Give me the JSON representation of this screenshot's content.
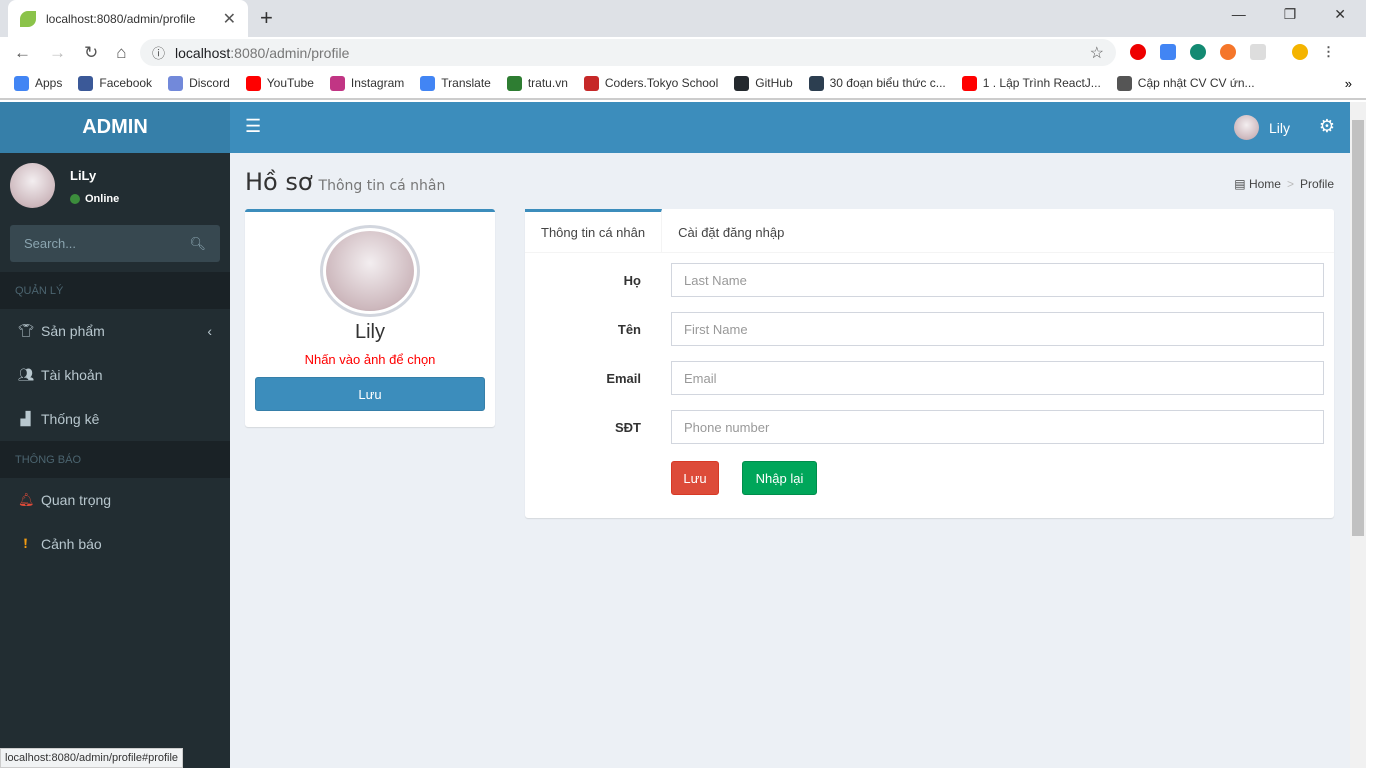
{
  "browser": {
    "tab_title": "localhost:8080/admin/profile",
    "url_host": "localhost",
    "url_rest": ":8080/admin/profile",
    "bookmarks": [
      {
        "label": "Apps",
        "color": "#4285f4"
      },
      {
        "label": "Facebook",
        "color": "#3b5998"
      },
      {
        "label": "Discord",
        "color": "#7289da"
      },
      {
        "label": "YouTube",
        "color": "#ff0000"
      },
      {
        "label": "Instagram",
        "color": "#c13584"
      },
      {
        "label": "Translate",
        "color": "#4285f4"
      },
      {
        "label": "tratu.vn",
        "color": "#2e7d32"
      },
      {
        "label": "Coders.Tokyo School",
        "color": "#c62828"
      },
      {
        "label": "GitHub",
        "color": "#24292e"
      },
      {
        "label": "30 đoạn biểu thức c...",
        "color": "#2c3e50"
      },
      {
        "label": "1 . Lập Trình ReactJ...",
        "color": "#ff0000"
      },
      {
        "label": "Cập nhật CV CV ứn...",
        "color": "#555555"
      }
    ],
    "status_url": "localhost:8080/admin/profile#profile"
  },
  "sidebar": {
    "logo": "ADMIN",
    "user_name": "LiLy",
    "status": "Online",
    "search_placeholder": "Search...",
    "section1": "QUẢN LÝ",
    "items1": [
      {
        "label": "Sản phẩm",
        "icon": "shirt-icon"
      },
      {
        "label": "Tài khoản",
        "icon": "users-icon"
      },
      {
        "label": "Thống kê",
        "icon": "bar-chart-icon"
      }
    ],
    "section2": "THÔNG BÁO",
    "items2": [
      {
        "label": "Quan trọng",
        "icon": "bell-icon"
      },
      {
        "label": "Cảnh báo",
        "icon": "warning-icon"
      }
    ]
  },
  "header": {
    "user_name": "Lily"
  },
  "content": {
    "title": "Hồ sơ",
    "subtitle": "Thông tin cá nhân",
    "breadcrumb": [
      "Home",
      "Profile"
    ]
  },
  "profile_card": {
    "name": "Lily",
    "hint": "Nhấn vào ảnh để chọn",
    "save": "Lưu"
  },
  "form": {
    "tabs": [
      "Thông tin cá nhân",
      "Cài đặt đăng nhập"
    ],
    "fields": [
      {
        "label": "Họ",
        "placeholder": "Last Name"
      },
      {
        "label": "Tên",
        "placeholder": "First Name"
      },
      {
        "label": "Email",
        "placeholder": "Email"
      },
      {
        "label": "SĐT",
        "placeholder": "Phone number"
      }
    ],
    "save": "Lưu",
    "reset": "Nhập lại"
  },
  "colors": {
    "primary": "#3c8dbc",
    "danger": "#dd4b39",
    "success": "#00a65a",
    "sidebar": "#222d32"
  }
}
